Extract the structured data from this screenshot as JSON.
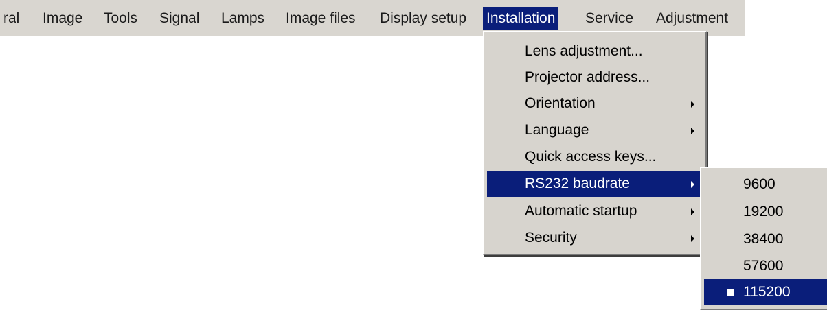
{
  "menubar": {
    "items": [
      {
        "label": "ral"
      },
      {
        "label": "Image"
      },
      {
        "label": "Tools"
      },
      {
        "label": "Signal"
      },
      {
        "label": "Lamps"
      },
      {
        "label": "Image files"
      },
      {
        "label": "Display setup"
      },
      {
        "label": "Installation",
        "active": true
      },
      {
        "label": "Service"
      },
      {
        "label": "Adjustment"
      }
    ]
  },
  "installation_menu": {
    "items": [
      {
        "label": "Lens adjustment...",
        "has_submenu": false
      },
      {
        "label": "Projector address...",
        "has_submenu": false
      },
      {
        "label": "Orientation",
        "has_submenu": true
      },
      {
        "label": "Language",
        "has_submenu": true
      },
      {
        "label": "Quick access keys...",
        "has_submenu": false
      },
      {
        "label": "RS232 baudrate",
        "has_submenu": true,
        "active": true
      },
      {
        "label": "Automatic startup",
        "has_submenu": true
      },
      {
        "label": "Security",
        "has_submenu": true
      }
    ]
  },
  "baudrate_submenu": {
    "items": [
      {
        "label": "9600"
      },
      {
        "label": "19200"
      },
      {
        "label": "38400"
      },
      {
        "label": "57600"
      },
      {
        "label": "115200",
        "selected": true
      }
    ]
  },
  "colors": {
    "menu_background": "#d7d4ce",
    "highlight": "#0a1e7a",
    "highlight_text": "#ffffff",
    "text": "#000000"
  }
}
